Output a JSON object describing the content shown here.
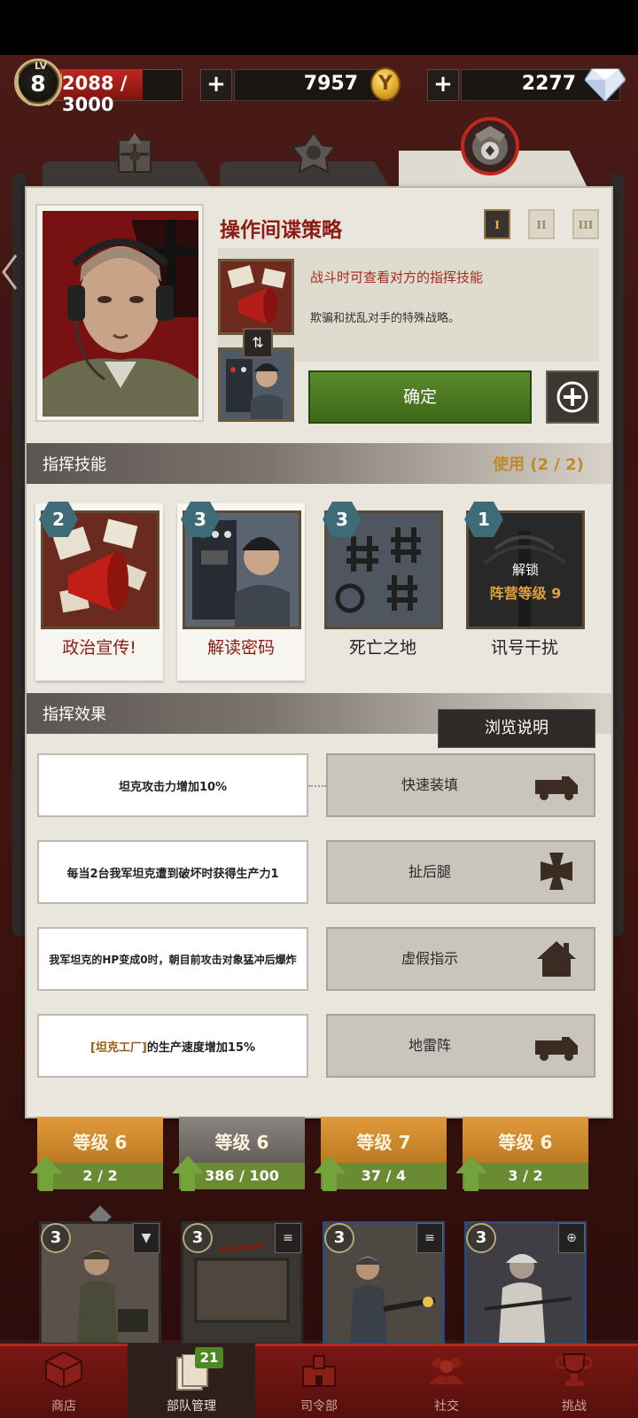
{
  "resources": {
    "level_label": "LV",
    "level": "8",
    "xp": "2088 / 3000",
    "xp_fraction": 0.696,
    "gold_plus": "+",
    "gold": "7957",
    "diamond_plus": "+",
    "diamonds": "2277"
  },
  "tabs": [
    {
      "icon": "eagle-emblem-icon"
    },
    {
      "icon": "cross-emblem-icon"
    },
    {
      "icon": "eagle-seal-icon",
      "active": true
    }
  ],
  "strategy": {
    "title": "操作间谍策略",
    "ranks": [
      "I",
      "II",
      "III"
    ],
    "active_rank": 0,
    "desc_primary": "战斗时可查看对方的指挥技能",
    "desc_secondary": "欺骗和扰乱对手的特殊战略。",
    "confirm": "确定"
  },
  "command_skills": {
    "title": "指挥技能",
    "usage": "使用 (2 / 2)",
    "items": [
      {
        "level": "2",
        "label": "政治宣传!",
        "selected": true
      },
      {
        "level": "3",
        "label": "解读密码",
        "selected": true
      },
      {
        "level": "3",
        "label": "死亡之地",
        "selected": false
      },
      {
        "level": "1",
        "label": "讯号干扰",
        "selected": false,
        "locked_text": "解锁",
        "locked_req": "阵营等级 9"
      }
    ]
  },
  "command_effects": {
    "title": "指挥效果",
    "browse": "浏览说明",
    "rows": [
      {
        "effect": "坦克攻击力增加10%",
        "name": "快速装填",
        "icon": "truck-icon"
      },
      {
        "effect": "每当2台我军坦克遭到破坏时获得生产力1",
        "name": "扯后腿",
        "icon": "iron-cross-icon"
      },
      {
        "effect": "我军坦克的HP变成0时，朝目前攻击对象猛冲后爆炸",
        "name": "虚假指示",
        "icon": "house-icon"
      },
      {
        "effect_prefix": "[坦克工厂]",
        "effect_suffix": "的生产速度增加15%",
        "name": "地雷阵",
        "icon": "truck-icon"
      }
    ]
  },
  "units_top": [
    {
      "level": "等级 6",
      "count": "2 / 2"
    },
    {
      "level": "等级 6",
      "count": "386 / 100"
    },
    {
      "level": "等级 7",
      "count": "37 / 4"
    },
    {
      "level": "等级 6",
      "count": "3 / 2"
    }
  ],
  "units_bottom": [
    {
      "badge": "3",
      "type": "tie"
    },
    {
      "badge": "3",
      "type": "list"
    },
    {
      "badge": "3",
      "type": "list"
    },
    {
      "badge": "3",
      "type": "crosshair"
    }
  ],
  "nav": {
    "items": [
      {
        "label": "商店",
        "icon": "box-icon"
      },
      {
        "label": "部队管理",
        "icon": "cards-icon",
        "badge": "21",
        "active": true
      },
      {
        "label": "司令部",
        "icon": "hq-icon"
      },
      {
        "label": "社交",
        "icon": "people-icon"
      },
      {
        "label": "挑战",
        "icon": "trophy-icon"
      }
    ]
  },
  "colors": {
    "accent_red": "#8b1c14",
    "confirm_green": "#4a7a20",
    "gold": "#c08a29"
  }
}
